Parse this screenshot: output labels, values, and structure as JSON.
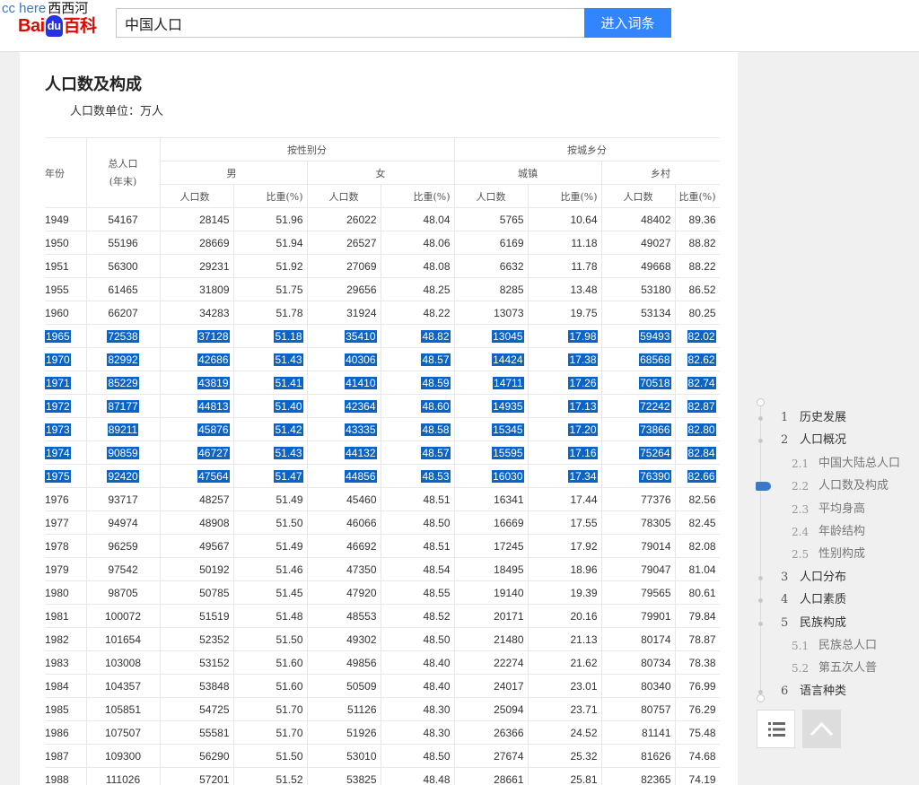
{
  "watermark": {
    "latin": "cc here",
    "cn": "西西河"
  },
  "logo": {
    "part1": "Bai",
    "paw": "du",
    "part2": "百科"
  },
  "search": {
    "value": "中国人口",
    "button": "进入词条"
  },
  "section": {
    "title": "人口数及构成",
    "unit": "人口数单位：万人"
  },
  "table": {
    "header": {
      "year": "年份",
      "total": "总人口",
      "total_sub": "(年末)",
      "by_gender": "按性别分",
      "by_area": "按城乡分",
      "male": "男",
      "female": "女",
      "urban": "城镇",
      "rural": "乡村",
      "count": "人口数",
      "ratio": "比重(%)"
    },
    "rows": [
      [
        "1949",
        "54167",
        "28145",
        "51.96",
        "26022",
        "48.04",
        "5765",
        "10.64",
        "48402",
        "89.36"
      ],
      [
        "1950",
        "55196",
        "28669",
        "51.94",
        "26527",
        "48.06",
        "6169",
        "11.18",
        "49027",
        "88.82"
      ],
      [
        "1951",
        "56300",
        "29231",
        "51.92",
        "27069",
        "48.08",
        "6632",
        "11.78",
        "49668",
        "88.22"
      ],
      [
        "1955",
        "61465",
        "31809",
        "51.75",
        "29656",
        "48.25",
        "8285",
        "13.48",
        "53180",
        "86.52"
      ],
      [
        "1960",
        "66207",
        "34283",
        "51.78",
        "31924",
        "48.22",
        "13073",
        "19.75",
        "53134",
        "80.25"
      ],
      [
        "1965",
        "72538",
        "37128",
        "51.18",
        "35410",
        "48.82",
        "13045",
        "17.98",
        "59493",
        "82.02"
      ],
      [
        "1970",
        "82992",
        "42686",
        "51.43",
        "40306",
        "48.57",
        "14424",
        "17.38",
        "68568",
        "82.62"
      ],
      [
        "1971",
        "85229",
        "43819",
        "51.41",
        "41410",
        "48.59",
        "14711",
        "17.26",
        "70518",
        "82.74"
      ],
      [
        "1972",
        "87177",
        "44813",
        "51.40",
        "42364",
        "48.60",
        "14935",
        "17.13",
        "72242",
        "82.87"
      ],
      [
        "1973",
        "89211",
        "45876",
        "51.42",
        "43335",
        "48.58",
        "15345",
        "17.20",
        "73866",
        "82.80"
      ],
      [
        "1974",
        "90859",
        "46727",
        "51.43",
        "44132",
        "48.57",
        "15595",
        "17.16",
        "75264",
        "82.84"
      ],
      [
        "1975",
        "92420",
        "47564",
        "51.47",
        "44856",
        "48.53",
        "16030",
        "17.34",
        "76390",
        "82.66"
      ],
      [
        "1976",
        "93717",
        "48257",
        "51.49",
        "45460",
        "48.51",
        "16341",
        "17.44",
        "77376",
        "82.56"
      ],
      [
        "1977",
        "94974",
        "48908",
        "51.50",
        "46066",
        "48.50",
        "16669",
        "17.55",
        "78305",
        "82.45"
      ],
      [
        "1978",
        "96259",
        "49567",
        "51.49",
        "46692",
        "48.51",
        "17245",
        "17.92",
        "79014",
        "82.08"
      ],
      [
        "1979",
        "97542",
        "50192",
        "51.46",
        "47350",
        "48.54",
        "18495",
        "18.96",
        "79047",
        "81.04"
      ],
      [
        "1980",
        "98705",
        "50785",
        "51.45",
        "47920",
        "48.55",
        "19140",
        "19.39",
        "79565",
        "80.61"
      ],
      [
        "1981",
        "100072",
        "51519",
        "51.48",
        "48553",
        "48.52",
        "20171",
        "20.16",
        "79901",
        "79.84"
      ],
      [
        "1982",
        "101654",
        "52352",
        "51.50",
        "49302",
        "48.50",
        "21480",
        "21.13",
        "80174",
        "78.87"
      ],
      [
        "1983",
        "103008",
        "53152",
        "51.60",
        "49856",
        "48.40",
        "22274",
        "21.62",
        "80734",
        "78.38"
      ],
      [
        "1984",
        "104357",
        "53848",
        "51.60",
        "50509",
        "48.40",
        "24017",
        "23.01",
        "80340",
        "76.99"
      ],
      [
        "1985",
        "105851",
        "54725",
        "51.70",
        "51126",
        "48.30",
        "25094",
        "23.71",
        "80757",
        "76.29"
      ],
      [
        "1986",
        "107507",
        "55581",
        "51.70",
        "51926",
        "48.30",
        "26366",
        "24.52",
        "81141",
        "75.48"
      ],
      [
        "1987",
        "109300",
        "56290",
        "51.50",
        "53010",
        "48.50",
        "27674",
        "25.32",
        "81626",
        "74.68"
      ],
      [
        "1988",
        "111026",
        "57201",
        "51.52",
        "53825",
        "48.48",
        "28661",
        "25.81",
        "82365",
        "74.19"
      ]
    ],
    "selected_rows": [
      5,
      6,
      7,
      8,
      9,
      10,
      11
    ]
  },
  "toc": [
    {
      "num": "1",
      "label": "历史发展",
      "level": 1
    },
    {
      "num": "2",
      "label": "人口概况",
      "level": 1
    },
    {
      "num": "2.1",
      "label": "中国大陆总人口",
      "level": 2
    },
    {
      "num": "2.2",
      "label": "人口数及构成",
      "level": 2,
      "active": true
    },
    {
      "num": "2.3",
      "label": "平均身高",
      "level": 2
    },
    {
      "num": "2.4",
      "label": "年龄结构",
      "level": 2
    },
    {
      "num": "2.5",
      "label": "性别构成",
      "level": 2
    },
    {
      "num": "3",
      "label": "人口分布",
      "level": 1
    },
    {
      "num": "4",
      "label": "人口素质",
      "level": 1
    },
    {
      "num": "5",
      "label": "民族构成",
      "level": 1
    },
    {
      "num": "5.1",
      "label": "民族总人口",
      "level": 2
    },
    {
      "num": "5.2",
      "label": "第五次人普",
      "level": 2
    },
    {
      "num": "6",
      "label": "语言种类",
      "level": 1
    }
  ],
  "icons": {
    "list": "list-icon",
    "top": "back-to-top-icon"
  },
  "colors": {
    "accent": "#3385ff",
    "selection": "#0a64c8",
    "logo_red": "#e10602",
    "logo_blue": "#2932e1"
  }
}
